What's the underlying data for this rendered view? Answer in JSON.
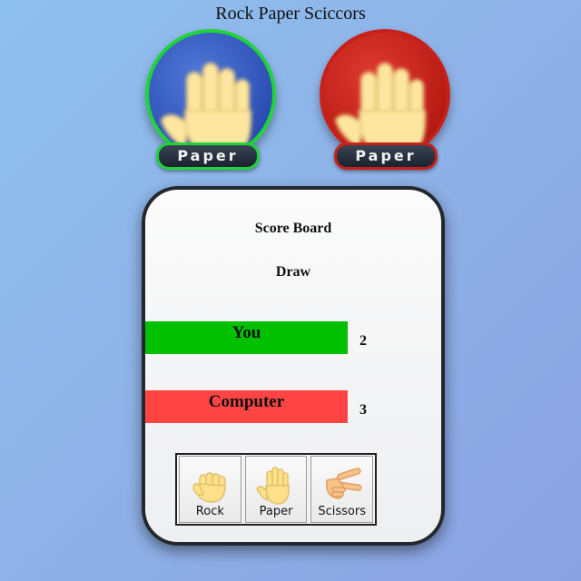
{
  "title": "Rock Paper Sciccors",
  "player": {
    "choice": "Paper",
    "icon": "open-hand-icon",
    "ring_color": "#1fd43a"
  },
  "computer": {
    "choice": "Paper",
    "icon": "open-hand-icon",
    "ring_color": "#c8201a"
  },
  "scoreboard": {
    "title": "Score Board",
    "result": "Draw",
    "you": {
      "label": "You",
      "score": "2",
      "color": "#00c000"
    },
    "computer": {
      "label": "Computer",
      "score": "3",
      "color": "#ff4444"
    }
  },
  "buttons": [
    {
      "label": "Rock",
      "icon": "fist-icon"
    },
    {
      "label": "Paper",
      "icon": "open-hand-icon"
    },
    {
      "label": "Scissors",
      "icon": "victory-hand-icon"
    }
  ]
}
